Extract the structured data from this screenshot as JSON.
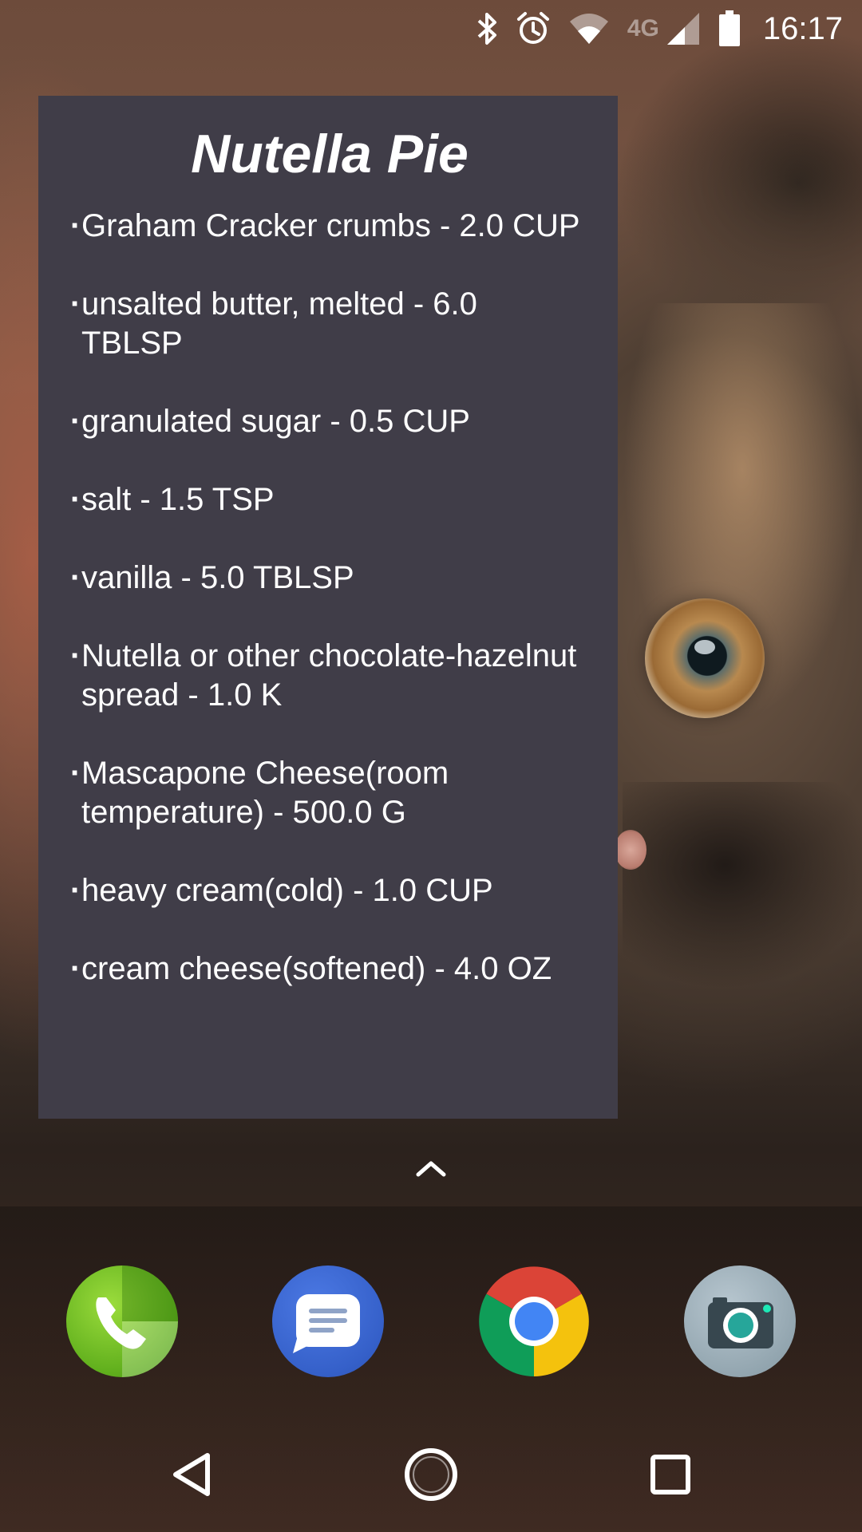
{
  "status_bar": {
    "network": "4G",
    "time": "16:17"
  },
  "recipe": {
    "title": "Nutella Pie",
    "ingredients": [
      "Graham Cracker crumbs - 2.0 CUP",
      "unsalted butter, melted - 6.0 TBLSP",
      "granulated sugar - 0.5 CUP",
      "salt - 1.5 TSP",
      "vanilla - 5.0 TBLSP",
      "Nutella or other chocolate-hazelnut spread - 1.0 K",
      "Mascapone Cheese(room temperature) - 500.0 G",
      "heavy cream(cold) - 1.0 CUP",
      "cream cheese(softened) - 4.0 OZ"
    ]
  },
  "icons": {
    "status": [
      "bluetooth-icon",
      "alarm-icon",
      "wifi-icon",
      "cell-signal-icon",
      "battery-icon"
    ],
    "dock": [
      "phone-icon",
      "messages-icon",
      "chrome-icon",
      "camera-icon"
    ],
    "nav": [
      "back-icon",
      "home-icon",
      "recents-icon"
    ]
  },
  "colors": {
    "widget_background": "#403d48",
    "text": "#ffffff"
  }
}
